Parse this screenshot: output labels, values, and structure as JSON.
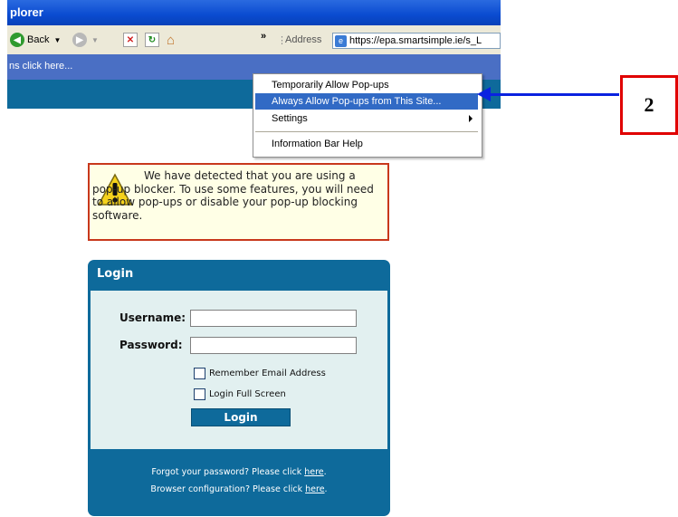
{
  "window": {
    "title_fragment": "plorer"
  },
  "toolbar": {
    "back_label": "Back",
    "address_label": "Address",
    "address_value": "https://epa.smartsimple.ie/s_L",
    "chevron": "»"
  },
  "infobar": {
    "text": "ns click here..."
  },
  "context_menu": {
    "items": [
      {
        "label": "Temporarily Allow Pop-ups"
      },
      {
        "label": "Always Allow Pop-ups from This Site..."
      },
      {
        "label": "Settings"
      },
      {
        "label": "Information Bar Help"
      }
    ]
  },
  "annotation": {
    "number": "2",
    "arrow_color": "#0a22e0",
    "box_color": "#e00000"
  },
  "warning": {
    "text": "We have detected that you are using a pop-up blocker. To use some features, you will need to allow pop-ups or disable your pop-up blocking software."
  },
  "login": {
    "title": "Login",
    "username_label": "Username:",
    "username_value": "",
    "password_label": "Password:",
    "password_value": "",
    "remember_label": "Remember Email Address",
    "fullscreen_label": "Login Full Screen",
    "button_label": "Login",
    "forgot_text": "Forgot your password? Please click",
    "browser_text": "Browser configuration? Please click",
    "here_link": "here",
    "period": "."
  },
  "colors": {
    "brand_blue": "#0e6a9b",
    "menu_highlight": "#316ac5",
    "panel_bg": "#e2f0f0"
  }
}
